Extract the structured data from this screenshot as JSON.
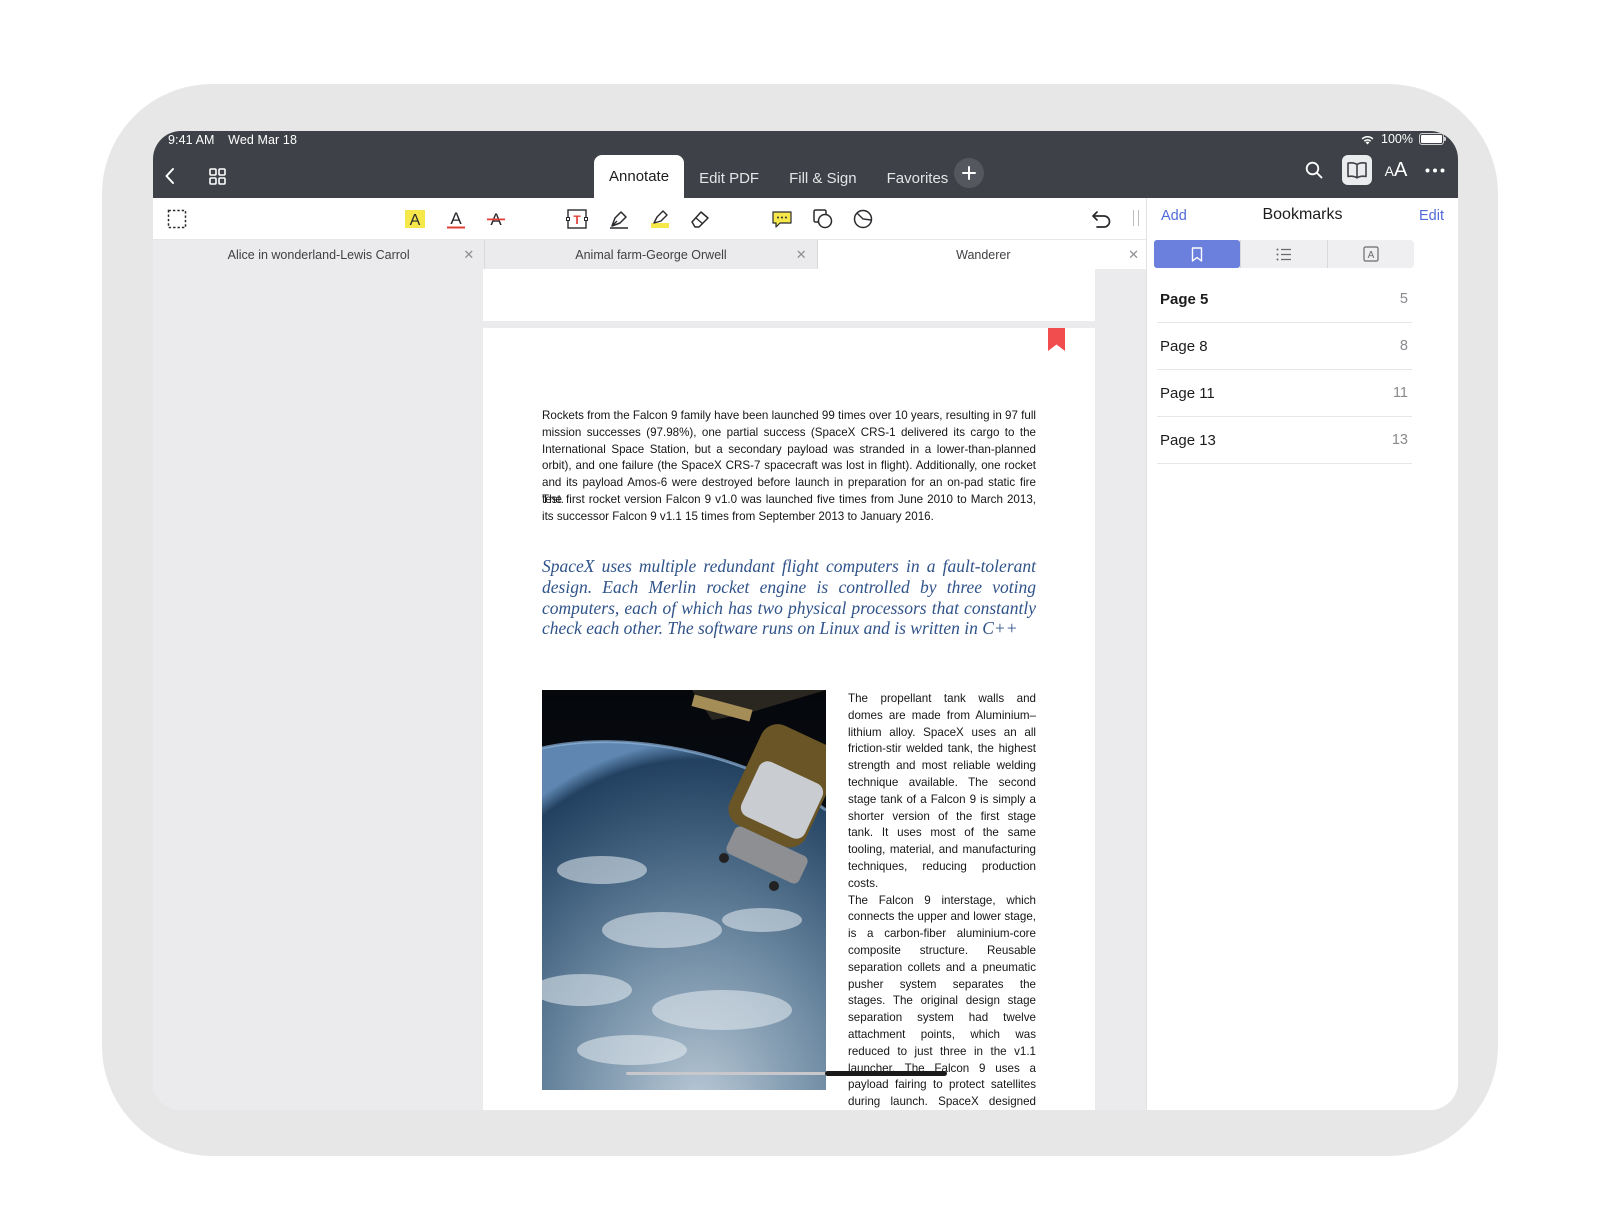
{
  "status_bar": {
    "time": "9:41 AM",
    "date": "Wed Mar 18",
    "battery": "100%"
  },
  "nav": {
    "tabs": [
      {
        "label": "Annotate",
        "active": true
      },
      {
        "label": "Edit PDF",
        "active": false
      },
      {
        "label": "Fill & Sign",
        "active": false
      },
      {
        "label": "Favorites",
        "active": false
      }
    ],
    "text_size_label": "AA"
  },
  "toolbar": {
    "tools": [
      "select-area",
      "highlight-text",
      "underline-text",
      "strikethrough-text",
      "text-box",
      "pen",
      "highlighter",
      "eraser",
      "comment",
      "shapes",
      "stamp"
    ],
    "accent_highlight": "#f6e84a",
    "accent_red": "#e0403a"
  },
  "document_tabs": [
    {
      "title": "Alice in wonderland-Lewis Carrol",
      "active": false
    },
    {
      "title": "Animal farm-George Orwell",
      "active": false
    },
    {
      "title": "Wanderer",
      "active": true
    }
  ],
  "document": {
    "para1": "Rockets from the Falcon 9 family have been launched 99 times over 10 years, resulting in 97 full mission successes (97.98%), one partial success (SpaceX CRS-1 delivered its cargo to the International Space Station, but a secondary payload was stranded in a lower-than-planned orbit), and one failure (the SpaceX CRS-7 spacecraft was lost in flight). Additionally, one rocket and its payload Amos-6 were destroyed before launch in preparation for an on-pad static fire test.",
    "para2": "The first rocket version Falcon 9 v1.0 was launched five times from June 2010 to March 2013, its successor Falcon 9 v1.1 15 times from September 2013 to January 2016.",
    "quote": "SpaceX uses multiple redundant flight computers in a fault-tolerant design. Each Merlin rocket engine is controlled by three voting computers, each of which has two physical processors that constantly check each other. The software runs on Linux and is written in C++",
    "column_text_1": "The propellant tank walls and domes are made from Aluminium–lithium alloy. SpaceX uses an all friction-stir welded tank, the highest strength and most reliable welding technique available. The second stage tank of a Falcon 9 is simply a shorter version of the first stage tank. It uses most of the same tooling, material, and manufacturing techniques, reducing production costs.",
    "column_text_2": "The Falcon 9 interstage, which connects the upper and lower stage, is a carbon-fiber aluminium-core composite structure. Reusable separation collets and a pneumatic pusher system separates the stages. The original design stage separation system had twelve attachment points, which was reduced to just three in the v1.1 launcher. The Falcon 9 uses a payload fairing to protect satellites during launch. SpaceX designed and fabricates fairings at its headquarters",
    "quote_color": "#30538a",
    "bookmark_color": "#f14d4f"
  },
  "bookmarks_panel": {
    "add_label": "Add",
    "title": "Bookmarks",
    "edit_label": "Edit",
    "segments": [
      "bookmarks",
      "outline",
      "annotations"
    ],
    "active_segment": "bookmarks",
    "accent": "#6b7fdc",
    "items": [
      {
        "label": "Page 5",
        "page": "5",
        "selected": true
      },
      {
        "label": "Page 8",
        "page": "8",
        "selected": false
      },
      {
        "label": "Page 11",
        "page": "11",
        "selected": false
      },
      {
        "label": "Page 13",
        "page": "13",
        "selected": false
      }
    ]
  }
}
